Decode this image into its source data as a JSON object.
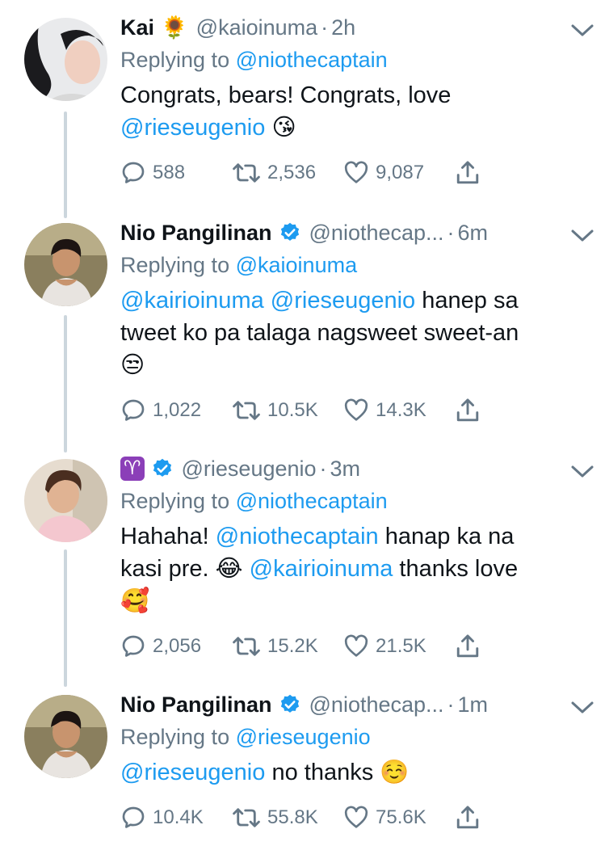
{
  "tweets": [
    {
      "name": "Kai",
      "name_emoji": "🌻",
      "verified": false,
      "handle": "@kaioinuma",
      "time": "2h",
      "replying_label": "Replying to",
      "replying_to": "@niothecaptain",
      "text_parts": [
        "Congrats, bears! Congrats, love",
        "@rieseugenio",
        "😘"
      ],
      "replies": "588",
      "retweets": "2,536",
      "likes": "9,087"
    },
    {
      "name": "Nio Pangilinan",
      "verified": true,
      "handle": "@niothecap...",
      "time": "6m",
      "replying_label": "Replying to",
      "replying_to": "@kaioinuma",
      "text_parts": [
        "@kairioinuma",
        "@rieseugenio",
        "hanep sa",
        "tweet ko pa talaga nagsweet sweet-an",
        "😒"
      ],
      "replies": "1,022",
      "retweets": "10.5K",
      "likes": "14.3K"
    },
    {
      "name": "♈",
      "verified": true,
      "handle": "@rieseugenio",
      "time": "3m",
      "replying_label": "Replying to",
      "replying_to": "@niothecaptain",
      "text_parts": [
        "Hahaha!",
        "@niothecaptain",
        "hanap ka na",
        "kasi pre.",
        "😂",
        "@kairioinuma",
        "thanks love",
        "🥰"
      ],
      "replies": "2,056",
      "retweets": "15.2K",
      "likes": "21.5K"
    },
    {
      "name": "Nio Pangilinan",
      "verified": true,
      "handle": "@niothecap...",
      "time": "1m",
      "replying_label": "Replying to",
      "replying_to": "@rieseugenio",
      "text_parts": [
        "@rieseugenio",
        "no thanks",
        "☺️"
      ],
      "replies": "10.4K",
      "retweets": "55.8K",
      "likes": "75.6K"
    }
  ],
  "separator": "·",
  "colors": {
    "link": "#1d9bf0",
    "muted": "#657786",
    "verified": "#1d9bf0",
    "thread_line": "#ccd6dd"
  }
}
